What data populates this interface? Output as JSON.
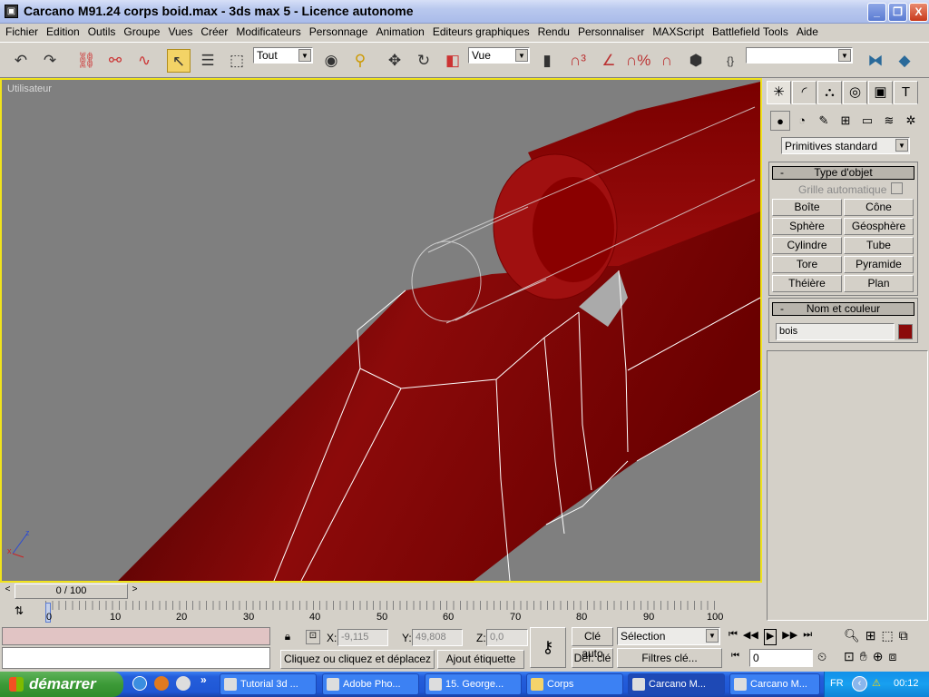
{
  "window": {
    "title": "Carcano M91.24 corps boid.max - 3ds max 5 - Licence autonome",
    "minimize": "_",
    "maximize": "❐",
    "close": "X"
  },
  "menu": [
    "Fichier",
    "Edition",
    "Outils",
    "Groupe",
    "Vues",
    "Créer",
    "Modificateurs",
    "Personnage",
    "Animation",
    "Editeurs graphiques",
    "Rendu",
    "Personnaliser",
    "MAXScript",
    "Battlefield Tools",
    "Aide"
  ],
  "toolbar": {
    "selection_filter": "Tout",
    "coord_system": "Vue",
    "named_selection": "",
    "active_tool": "select"
  },
  "viewport": {
    "label": "Utilisateur",
    "axis_x": "x",
    "axis_z": "z",
    "model_color": "#8b0000",
    "border_color": "#f0e31c"
  },
  "command_panel": {
    "category": "Primitives standard",
    "type_rollout": "Type d'objet",
    "autogrid": "Grille automatique",
    "buttons": [
      "Boîte",
      "Cône",
      "Sphère",
      "Géosphère",
      "Cylindre",
      "Tube",
      "Tore",
      "Pyramide",
      "Théière",
      "Plan"
    ],
    "name_rollout": "Nom et couleur",
    "object_name": "bois",
    "object_color": "#8b0a0a",
    "collapse": "-"
  },
  "timeline": {
    "slider": "0 / 100",
    "ticks": [
      "0",
      "10",
      "20",
      "30",
      "40",
      "50",
      "60",
      "70",
      "80",
      "90",
      "100"
    ],
    "prev": "<",
    "next": ">"
  },
  "status": {
    "x_label": "X:",
    "x": "-9,115",
    "y_label": "Y:",
    "y": "49,808",
    "z_label": "Z:",
    "z": "0,0",
    "prompt": "Cliquez ou cliquez et déplacez pou",
    "add_time_tag": "Ajout étiquette tps",
    "auto_key": "Clé auto",
    "set_key": "Déf. clé",
    "key_mode": "Sélection",
    "key_filters": "Filtres clé...",
    "frame": "0"
  },
  "taskbar": {
    "start": "démarrer",
    "more": "»",
    "tasks": [
      "Tutorial 3d ...",
      "Adobe Pho...",
      "15. George...",
      "Corps",
      "Carcano M...",
      "Carcano M..."
    ],
    "lang": "FR",
    "clock": "00:12"
  }
}
